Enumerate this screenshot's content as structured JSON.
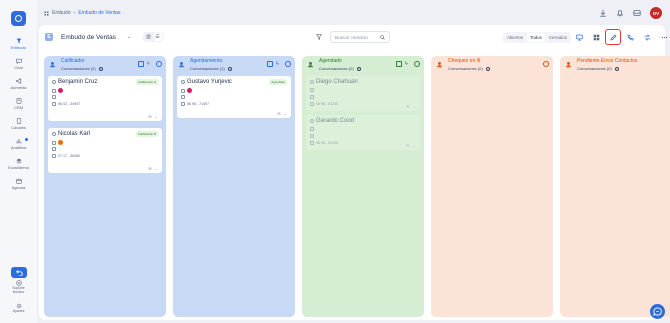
{
  "sidebar": {
    "items": [
      {
        "label": "Embudo",
        "icon": "funnel-icon",
        "active": true
      },
      {
        "label": "Chat",
        "icon": "chat-icon"
      },
      {
        "label": "Aumenta",
        "icon": "megaphone-icon"
      },
      {
        "label": "CRM",
        "icon": "contacts-icon"
      },
      {
        "label": "Canales",
        "icon": "channels-icon"
      },
      {
        "label": "Analítica",
        "icon": "analytics-icon",
        "dot": true
      },
      {
        "label": "Ecosistema",
        "icon": "ecosystem-icon"
      },
      {
        "label": "Agenda",
        "icon": "calendar-icon"
      }
    ],
    "support_label_1": "Soporte",
    "support_label_2": "técnico",
    "settings_label": "Ajustes"
  },
  "breadcrumb": {
    "root": "Embudo",
    "separator": "›",
    "current": "Embudo de Ventas"
  },
  "user": {
    "initials": "DV"
  },
  "toolbar": {
    "pipeline_badge": "E",
    "pipeline_name": "Embudo de Ventas",
    "search_placeholder": "Buscar contacto",
    "status_tabs": [
      "Abiertos",
      "Todos",
      "Cerrados"
    ],
    "active_status": "Todos"
  },
  "columns": [
    {
      "title": "Calificador",
      "subtitle": "Conversaciones (2)",
      "bg": "#c8d9f5",
      "head_color": "#2d6cdf",
      "cards": [
        {
          "name": "Benjamin Cruz",
          "badge": "Calificación A",
          "phone": "96 02 - 34907",
          "avatar": "pink"
        },
        {
          "name": "Nicolas Karl",
          "badge": "Calificación B",
          "phone": "27 17 - 36450",
          "avatar": "orange"
        }
      ]
    },
    {
      "title": "Agendamiento",
      "subtitle": "Conversaciones (1)",
      "bg": "#c8d9f5",
      "head_color": "#2d6cdf",
      "cards": [
        {
          "name": "Gustavo Yurjevic",
          "badge": "Agendado",
          "phone": "56 96 - 71497",
          "avatar": "pink"
        }
      ]
    },
    {
      "title": "Agendado",
      "subtitle": "Conversaciones (0)",
      "bg": "#d5edd2",
      "head_color": "#2e7d32",
      "cards": [
        {
          "name": "Diego Chahuan",
          "phone": "56 96 - 81230"
        },
        {
          "name": "Gerardo Cood",
          "phone": "56 96 - 54198"
        }
      ]
    },
    {
      "title": "Chequeo en llt",
      "subtitle": "Conversaciones (0)",
      "bg": "#fbe3d8",
      "head_color": "#e65100",
      "cards": []
    },
    {
      "title": "Pendiente Envio Contactos",
      "subtitle": "Conversaciones (0)",
      "bg": "#fbe3d8",
      "head_color": "#e65100",
      "cards": []
    }
  ]
}
